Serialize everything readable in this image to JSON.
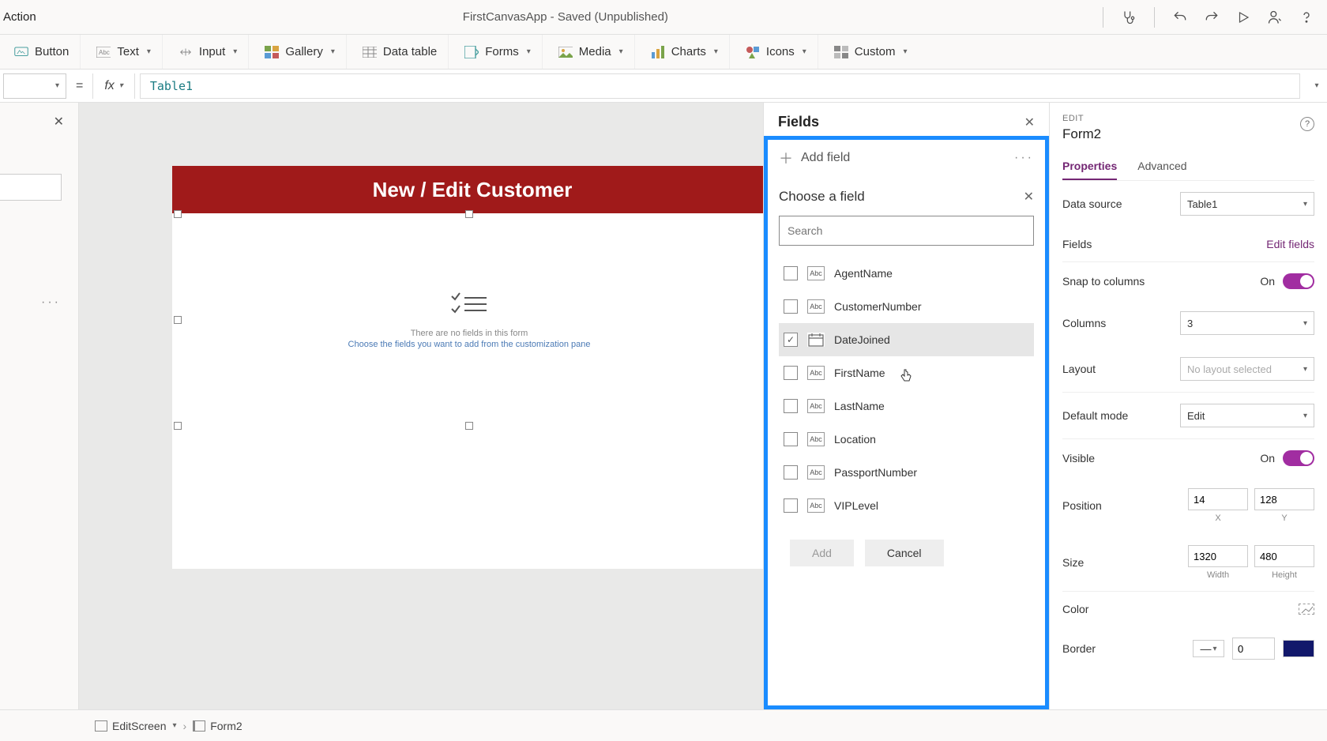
{
  "titlebar": {
    "left": "Action",
    "center": "FirstCanvasApp - Saved (Unpublished)"
  },
  "ribbon": {
    "button": "Button",
    "text": "Text",
    "input": "Input",
    "gallery": "Gallery",
    "data_table": "Data table",
    "forms": "Forms",
    "media": "Media",
    "charts": "Charts",
    "icons": "Icons",
    "custom": "Custom"
  },
  "formula": {
    "value": "Table1"
  },
  "canvas": {
    "banner": "New / Edit Customer",
    "empty_line1": "There are no fields in this form",
    "empty_line2": "Choose the fields you want to add from the customization pane"
  },
  "fields_panel": {
    "title": "Fields",
    "add_field": "Add field",
    "choose_title": "Choose a field",
    "search_placeholder": "Search",
    "items": [
      {
        "name": "AgentName",
        "type": "text",
        "checked": false
      },
      {
        "name": "CustomerNumber",
        "type": "text",
        "checked": false
      },
      {
        "name": "DateJoined",
        "type": "date",
        "checked": true
      },
      {
        "name": "FirstName",
        "type": "text",
        "checked": false
      },
      {
        "name": "LastName",
        "type": "text",
        "checked": false
      },
      {
        "name": "Location",
        "type": "text",
        "checked": false
      },
      {
        "name": "PassportNumber",
        "type": "text",
        "checked": false
      },
      {
        "name": "VIPLevel",
        "type": "text",
        "checked": false
      }
    ],
    "add_btn": "Add",
    "cancel_btn": "Cancel"
  },
  "props": {
    "sub": "EDIT",
    "title": "Form2",
    "tab_properties": "Properties",
    "tab_advanced": "Advanced",
    "data_source_label": "Data source",
    "data_source_value": "Table1",
    "fields_label": "Fields",
    "edit_fields": "Edit fields",
    "snap_label": "Snap to columns",
    "snap_value": "On",
    "columns_label": "Columns",
    "columns_value": "3",
    "layout_label": "Layout",
    "layout_value": "No layout selected",
    "default_mode_label": "Default mode",
    "default_mode_value": "Edit",
    "visible_label": "Visible",
    "visible_value": "On",
    "position_label": "Position",
    "pos_x": "14",
    "pos_y": "128",
    "x_label": "X",
    "y_label": "Y",
    "size_label": "Size",
    "size_w": "1320",
    "size_h": "480",
    "w_label": "Width",
    "h_label": "Height",
    "color_label": "Color",
    "border_label": "Border",
    "border_value": "0"
  },
  "breadcrumb": {
    "screen": "EditScreen",
    "form": "Form2"
  }
}
